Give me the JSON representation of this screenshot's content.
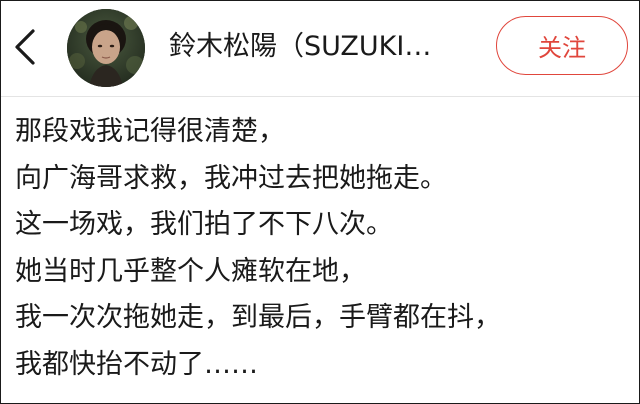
{
  "header": {
    "back_icon": "chevron-left-icon",
    "avatar_alt": "avatar",
    "profile_name": "鈴木松陽（SUZUKI…",
    "follow_label": "关注",
    "accent_color": "#e0463c"
  },
  "post": {
    "lines": [
      "那段戏我记得很清楚，",
      "向广海哥求救，我冲过去把她拖走。",
      "这一场戏，我们拍了不下八次。",
      "她当时几乎整个人瘫软在地，",
      "我一次次拖她走，到最后，手臂都在抖，",
      "我都快抬不动了……"
    ]
  }
}
